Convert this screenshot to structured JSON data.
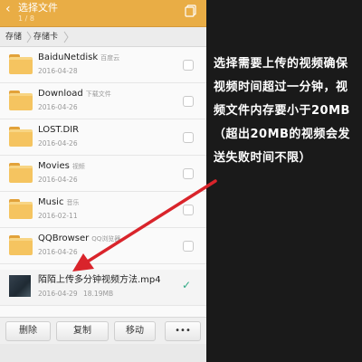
{
  "header": {
    "back_icon": "chevron-left-icon",
    "title": "选择文件",
    "subtitle": "1 / 8",
    "copy_icon": "copy-icon"
  },
  "breadcrumb": {
    "items": [
      "存储",
      "存储卡"
    ]
  },
  "files": [
    {
      "name": "BaiduNetdisk",
      "tag": "百度云",
      "date": "2016-04-28"
    },
    {
      "name": "Download",
      "tag": "下载文件",
      "date": "2016-04-26"
    },
    {
      "name": "LOST.DIR",
      "tag": "",
      "date": "2016-04-26"
    },
    {
      "name": "Movies",
      "tag": "视频",
      "date": "2016-04-26"
    },
    {
      "name": "Music",
      "tag": "音乐",
      "date": "2016-02-11"
    },
    {
      "name": "QQBrowser",
      "tag": "QQ浏览器",
      "date": "2016-04-26"
    }
  ],
  "selected_file": {
    "name": "陌陌上传多分钟视频方法.mp4",
    "date": "2016-04-29",
    "size": "18.19MB",
    "checked": true
  },
  "actions": {
    "delete": "删除",
    "copy": "复制",
    "move": "移动",
    "more": "•••"
  },
  "caption": "选择需要上传的视频确保视频时间超过一分钟，视频文件内存要小于20MB（超出20MB的视频会发送失败时间不限）",
  "colors": {
    "titlebar": "#e9ad45",
    "folder": "#f5c460",
    "check": "#2fa884",
    "arrow": "#d9242b"
  }
}
